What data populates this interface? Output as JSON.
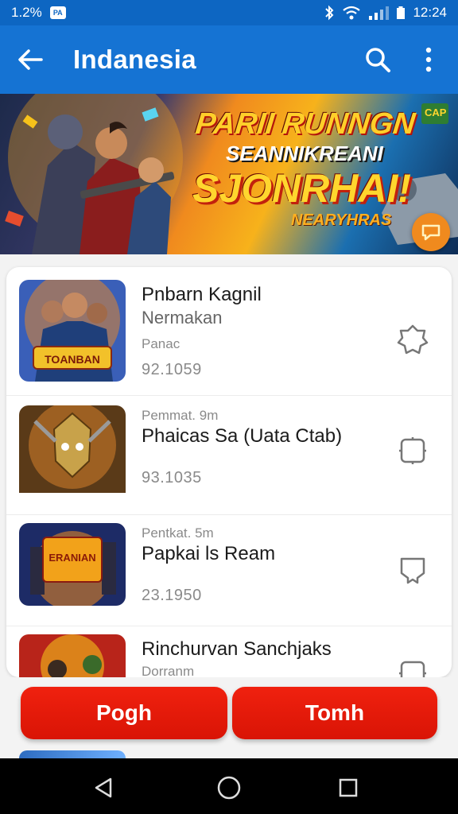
{
  "status_bar": {
    "left_text": "1.2%",
    "badge_text": "PA",
    "time": "12:24",
    "icons": [
      "bluetooth-icon",
      "wifi-icon",
      "signal-icon",
      "battery-icon"
    ]
  },
  "app_bar": {
    "title": "Indanesia",
    "icons": [
      "back-arrow-icon",
      "search-icon",
      "more-vert-icon"
    ],
    "color": "#1573d3"
  },
  "banner": {
    "line1": "PARII RUNNGN",
    "line2": "SEANNIKREANI",
    "line3": "SJONRHAI!",
    "line4": "NEARYHRAS",
    "thumb_caption": "CAP"
  },
  "items": [
    {
      "title": "Pnbarn Kagnil",
      "subtitle": "Nermakan",
      "small": "Panac",
      "number": "92.1059",
      "thumb_caption": "TOANBAN",
      "action_icon": "badge-icon"
    },
    {
      "small": "Pemmat. 9m",
      "title": "Phaicas Sa (Uata Ctab)",
      "number": "93.1035",
      "action_icon": "square-icon"
    },
    {
      "small": "Pentkat. 5m",
      "title": "Papkai ls Ream",
      "number": "23.1950",
      "thumb_caption": "ERANIAN",
      "action_icon": "shield-icon"
    },
    {
      "title": "Rinchurvan Sanchjaks",
      "small": "Dorranm",
      "action_icon": "square-icon"
    }
  ],
  "buttons": {
    "left": "Pogh",
    "right": "Tomh",
    "color": "#e8180a"
  },
  "nav": {
    "icons": [
      "back-triangle-icon",
      "home-circle-icon",
      "recents-square-icon"
    ]
  }
}
